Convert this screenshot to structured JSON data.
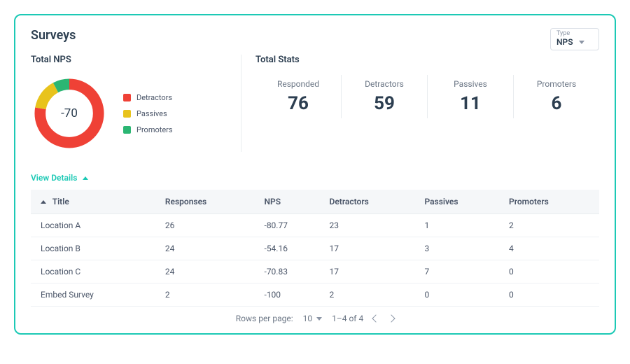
{
  "card": {
    "title": "Surveys"
  },
  "type_selector": {
    "label": "Type",
    "value": "NPS"
  },
  "total_nps": {
    "title": "Total NPS",
    "center_value": "-70",
    "legend": {
      "detractors": "Detractors",
      "passives": "Passives",
      "promoters": "Promoters"
    }
  },
  "total_stats": {
    "title": "Total Stats",
    "responded": {
      "label": "Responded",
      "value": "76"
    },
    "detractors": {
      "label": "Detractors",
      "value": "59"
    },
    "passives": {
      "label": "Passives",
      "value": "11"
    },
    "promoters": {
      "label": "Promoters",
      "value": "6"
    }
  },
  "view_details_label": "View Details",
  "table": {
    "headers": {
      "title": "Title",
      "responses": "Responses",
      "nps": "NPS",
      "detractors": "Detractors",
      "passives": "Passives",
      "promoters": "Promoters"
    },
    "rows": [
      {
        "title": "Location A",
        "responses": "26",
        "nps": "-80.77",
        "detractors": "23",
        "passives": "1",
        "promoters": "2"
      },
      {
        "title": "Location B",
        "responses": "24",
        "nps": "-54.16",
        "detractors": "17",
        "passives": "3",
        "promoters": "4"
      },
      {
        "title": "Location C",
        "responses": "24",
        "nps": "-70.83",
        "detractors": "17",
        "passives": "7",
        "promoters": "0"
      },
      {
        "title": "Embed Survey",
        "responses": "2",
        "nps": "-100",
        "detractors": "2",
        "passives": "0",
        "promoters": "0"
      }
    ]
  },
  "pagination": {
    "rows_per_page_label": "Rows per page:",
    "rows_per_page_value": "10",
    "range_text": "1–4 of 4"
  },
  "colors": {
    "detractors": "#ef4136",
    "passives": "#e8c31c",
    "promoters": "#2bb673",
    "accent": "#1cc9b5"
  },
  "chart_data": {
    "type": "pie",
    "title": "Total NPS",
    "series": [
      {
        "name": "Detractors",
        "value": 59,
        "color": "#ef4136"
      },
      {
        "name": "Passives",
        "value": 11,
        "color": "#e8c31c"
      },
      {
        "name": "Promoters",
        "value": 6,
        "color": "#2bb673"
      }
    ],
    "center_label": "-70"
  }
}
